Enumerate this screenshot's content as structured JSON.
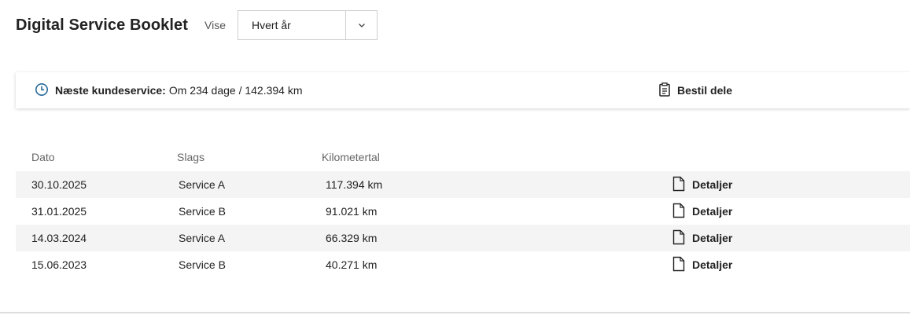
{
  "header": {
    "title": "Digital Service Booklet",
    "view_label": "Vise",
    "view_select": {
      "value": "Hvert år"
    }
  },
  "service_bar": {
    "next_service_label": "Næste kundeservice:",
    "next_service_value": "Om 234 dage / 142.394 km",
    "order_parts_label": "Bestil dele"
  },
  "table": {
    "columns": [
      "Dato",
      "Slags",
      "Kilometertal"
    ],
    "details_label": "Detaljer",
    "rows": [
      {
        "date": "30.10.2025",
        "type": "Service A",
        "km": "117.394 km"
      },
      {
        "date": "31.01.2025",
        "type": "Service B",
        "km": "91.021 km"
      },
      {
        "date": "14.03.2024",
        "type": "Service A",
        "km": "66.329 km"
      },
      {
        "date": "15.06.2023",
        "type": "Service B",
        "km": "40.271 km"
      }
    ]
  },
  "colors": {
    "accent_icon": "#2a6b9a",
    "row_shade": "#f4f4f4"
  }
}
